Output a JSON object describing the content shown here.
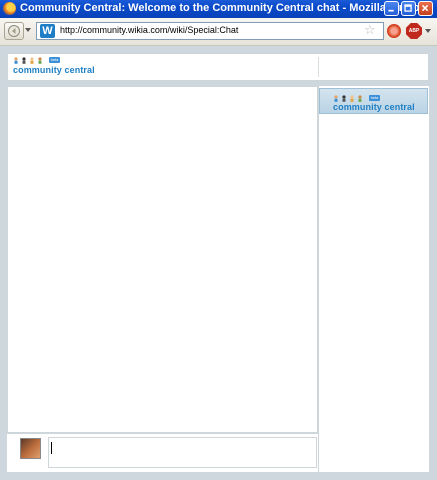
{
  "window": {
    "title": "Community Central: Welcome to the Community Central chat - Mozilla Firefox",
    "buttons": [
      "minimize",
      "maximize",
      "close"
    ]
  },
  "navbar": {
    "url": "http://community.wikia.com/wiki/Special:Chat",
    "site_icon_letter": "W",
    "abp_label": "ABP",
    "icons": [
      "back-icon",
      "bookmark-star-icon",
      "stop-icon",
      "adblock-icon"
    ]
  },
  "header": {
    "logo_text": "community central",
    "logo_badge": "beta"
  },
  "user_list": {
    "rooms": [
      {
        "label": "community central",
        "badge": "beta"
      }
    ]
  },
  "compose": {
    "value": "",
    "placeholder": ""
  },
  "colors": {
    "titlebar": "#0a4ac9",
    "page_background": "#ced7dd",
    "brand": "#1f7fc4",
    "room_highlight": "#c6dbe9"
  }
}
